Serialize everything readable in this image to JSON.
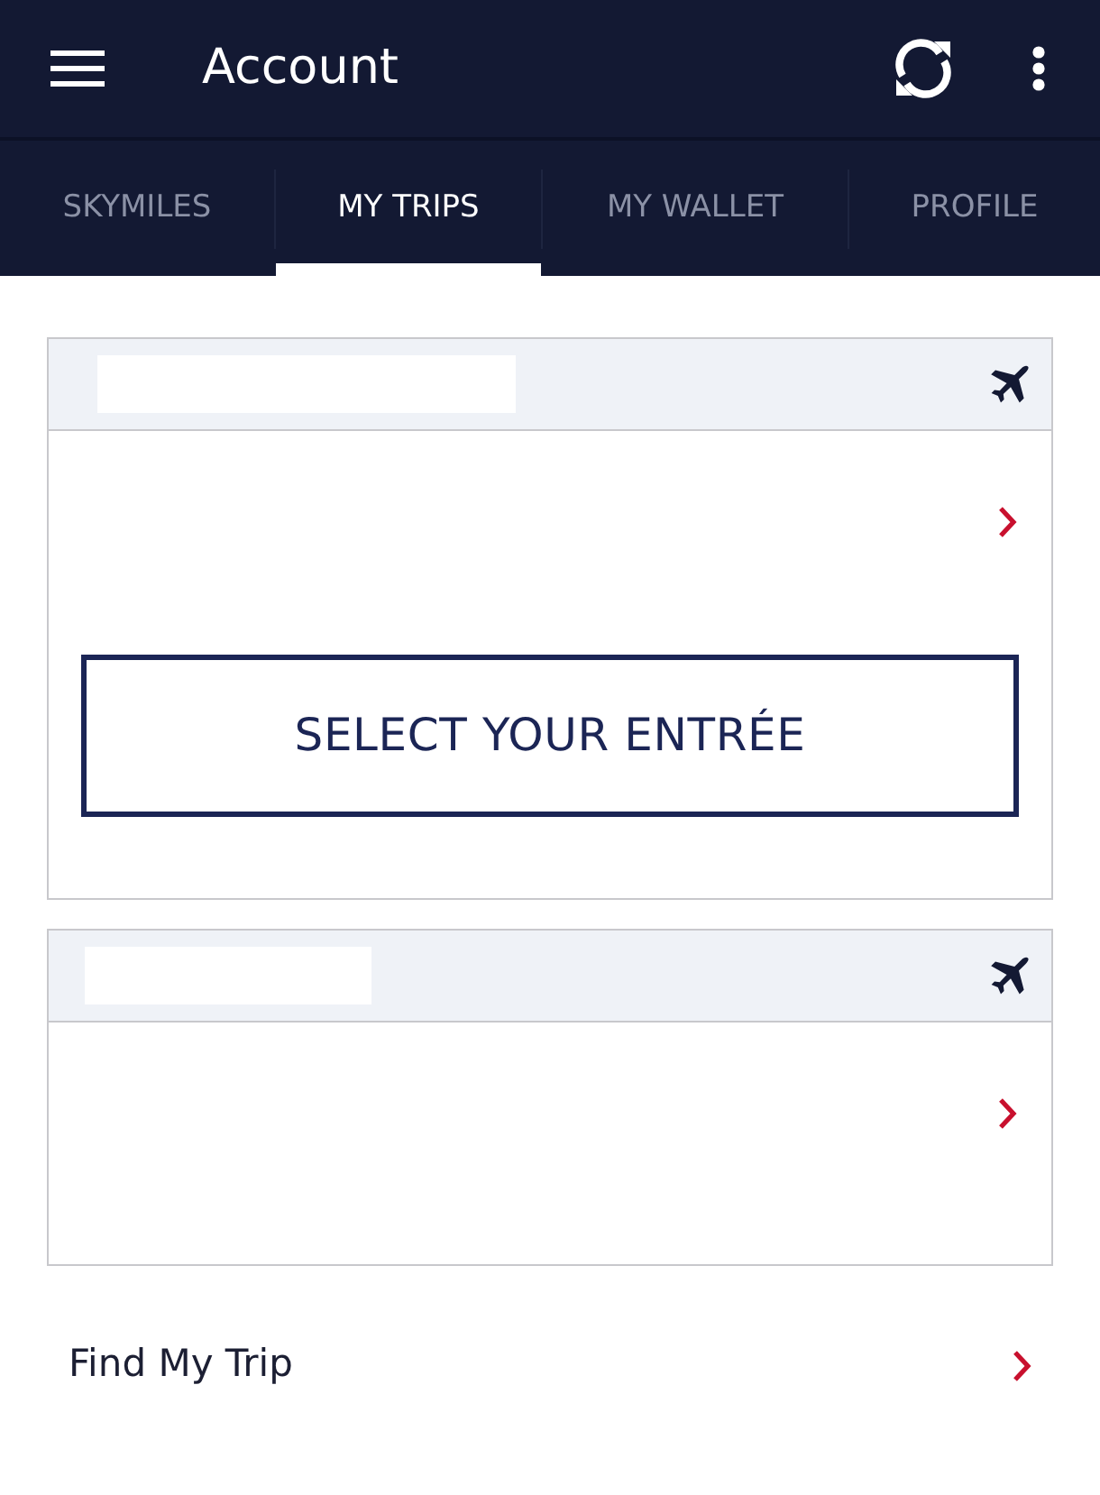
{
  "app_bar": {
    "title": "Account"
  },
  "tabs": [
    {
      "label": "SKYMILES",
      "selected": false
    },
    {
      "label": "MY TRIPS",
      "selected": true
    },
    {
      "label": "MY WALLET",
      "selected": false
    },
    {
      "label": "PROFILE",
      "selected": false
    }
  ],
  "trips": [
    {
      "kind": "flight",
      "button": "SELECT YOUR ENTRÉE"
    },
    {
      "kind": "flight"
    }
  ],
  "find_trip": {
    "label": "Find My Trip"
  }
}
